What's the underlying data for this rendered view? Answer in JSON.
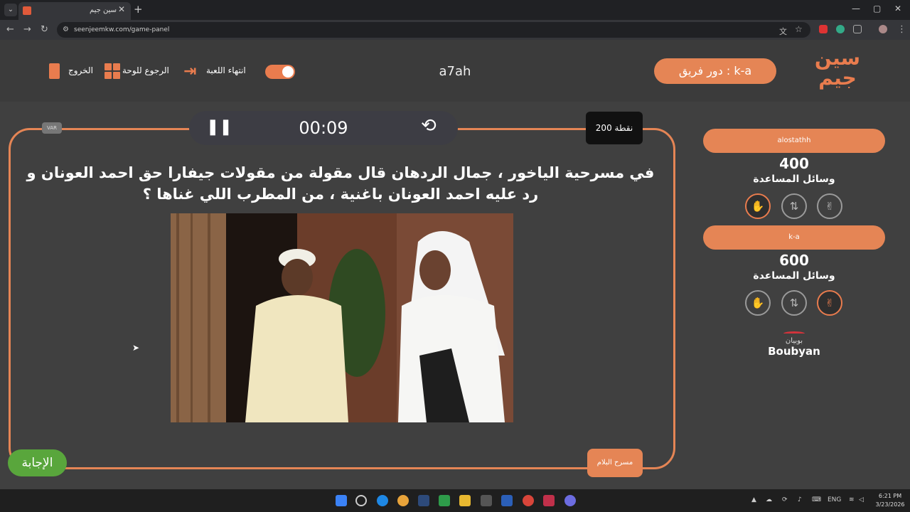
{
  "browser": {
    "tab_title": "سين جيم",
    "tab_close": "✕",
    "new_tab": "+",
    "url": "seenjeemkw.com/game-panel",
    "window_controls": [
      "—",
      "▢",
      "✕"
    ]
  },
  "header": {
    "logo_text": "سين جيم",
    "turn_label": "دور فريق : k-a",
    "game_name": "a7ah",
    "exit_label": "الخروج",
    "back_label": "الرجوع للوحة",
    "end_game_label": "انتهاء اللعبة"
  },
  "question": {
    "timer": "00:09",
    "points": "200 نقطة",
    "var_badge": "VAR",
    "text_line1": "في مسرحية الياخور ، جمال الردهان قال مقولة من مقولات جيفارا حق احمد العونان و",
    "text_line2": "رد عليه احمد العونان باغنية ، من المطرب اللي غناها ؟",
    "answer_button": "الإجابة",
    "category": "مسرح البلام"
  },
  "teams": [
    {
      "name": "alostathh",
      "score": "400",
      "help_label": "وسائل المساعدة",
      "active_help": 2
    },
    {
      "name": "k-a",
      "score": "600",
      "help_label": "وسائل المساعدة",
      "active_help": 0
    }
  ],
  "help_icons": [
    "peace-hand-icon",
    "swap-icon",
    "stop-hand-icon"
  ],
  "sponsor": {
    "arabic": "بوبيان",
    "english": "Boubyan"
  },
  "taskbar": {
    "lang": "ENG",
    "time": "6:21 PM",
    "date": "3/23/2026"
  },
  "colors": {
    "accent": "#e58555",
    "answer_green": "#59a63c",
    "background": "#404040"
  }
}
